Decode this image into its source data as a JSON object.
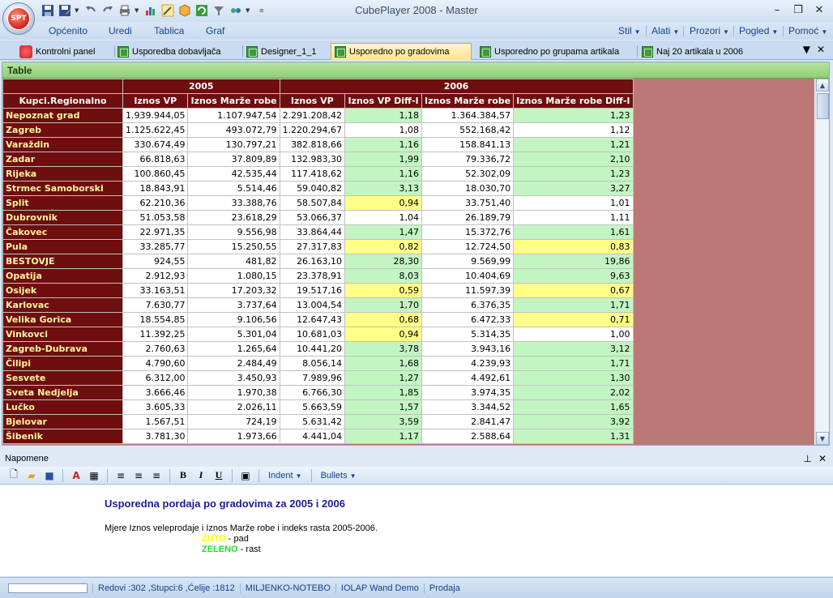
{
  "window": {
    "title": "CubePlayer 2008 - Master",
    "app_logo_text": "SPT"
  },
  "menu": {
    "items": [
      "Općenito",
      "Uredi",
      "Tablica",
      "Graf"
    ],
    "right_items": [
      "Stil",
      "Alati",
      "Prozori",
      "Pogled",
      "Pomoć"
    ]
  },
  "tabs": [
    {
      "label": "Kontrolni panel",
      "active": false
    },
    {
      "label": "Usporedba dobavljača",
      "active": false
    },
    {
      "label": "Designer_1_1",
      "active": false
    },
    {
      "label": "Usporedno po gradovima",
      "active": true
    },
    {
      "label": "Usporedno po grupama artikala",
      "active": false
    },
    {
      "label": "Naj 20 artikala u 2006",
      "active": false
    }
  ],
  "panel": {
    "title": "Table",
    "year_headers": [
      "2005",
      "2006"
    ],
    "row_header_title": "Kupci.Regionalno",
    "columns": [
      "Iznos VP",
      "Iznos Marže robe",
      "Iznos VP",
      "Iznos VP Diff-I",
      "Iznos Marže robe",
      "Iznos Marže robe Diff-I"
    ],
    "rows": [
      {
        "name": "Nepoznat grad",
        "v": [
          "1.939.944,05",
          "1.107.947,54",
          "2.291.208,42",
          "1,18",
          "1.364.384,57",
          "1,23"
        ],
        "c1": "green",
        "c2": "green"
      },
      {
        "name": "Zagreb",
        "v": [
          "1.125.622,45",
          "493.072,79",
          "1.220.294,67",
          "1,08",
          "552.168,42",
          "1,12"
        ],
        "c1": "white",
        "c2": "white"
      },
      {
        "name": "Varaždin",
        "v": [
          "330.674,49",
          "130.797,21",
          "382.818,66",
          "1,16",
          "158.841,13",
          "1,21"
        ],
        "c1": "green",
        "c2": "green"
      },
      {
        "name": "Zadar",
        "v": [
          "66.818,63",
          "37.809,89",
          "132.983,30",
          "1,99",
          "79.336,72",
          "2,10"
        ],
        "c1": "green",
        "c2": "green"
      },
      {
        "name": "Rijeka",
        "v": [
          "100.860,45",
          "42.535,44",
          "117.418,62",
          "1,16",
          "52.302,09",
          "1,23"
        ],
        "c1": "green",
        "c2": "green"
      },
      {
        "name": "Strmec Samoborski",
        "v": [
          "18.843,91",
          "5.514,46",
          "59.040,82",
          "3,13",
          "18.030,70",
          "3,27"
        ],
        "c1": "green",
        "c2": "green"
      },
      {
        "name": "Split",
        "v": [
          "62.210,36",
          "33.388,76",
          "58.507,84",
          "0,94",
          "33.751,40",
          "1,01"
        ],
        "c1": "yellow",
        "c2": "white"
      },
      {
        "name": "Dubrovnik",
        "v": [
          "51.053,58",
          "23.618,29",
          "53.066,37",
          "1,04",
          "26.189,79",
          "1,11"
        ],
        "c1": "white",
        "c2": "white"
      },
      {
        "name": "Čakovec",
        "v": [
          "22.971,35",
          "9.556,98",
          "33.864,44",
          "1,47",
          "15.372,76",
          "1,61"
        ],
        "c1": "green",
        "c2": "green"
      },
      {
        "name": "Pula",
        "v": [
          "33.285,77",
          "15.250,55",
          "27.317,83",
          "0,82",
          "12.724,50",
          "0,83"
        ],
        "c1": "yellow",
        "c2": "yellow"
      },
      {
        "name": "BESTOVJE",
        "v": [
          "924,55",
          "481,82",
          "26.163,10",
          "28,30",
          "9.569,99",
          "19,86"
        ],
        "c1": "green",
        "c2": "green"
      },
      {
        "name": "Opatija",
        "v": [
          "2.912,93",
          "1.080,15",
          "23.378,91",
          "8,03",
          "10.404,69",
          "9,63"
        ],
        "c1": "green",
        "c2": "green"
      },
      {
        "name": "Osijek",
        "v": [
          "33.163,51",
          "17.203,32",
          "19.517,16",
          "0,59",
          "11.597,39",
          "0,67"
        ],
        "c1": "yellow",
        "c2": "yellow"
      },
      {
        "name": "Karlovac",
        "v": [
          "7.630,77",
          "3.737,64",
          "13.004,54",
          "1,70",
          "6.376,35",
          "1,71"
        ],
        "c1": "green",
        "c2": "green"
      },
      {
        "name": "Velika Gorica",
        "v": [
          "18.554,85",
          "9.106,56",
          "12.647,43",
          "0,68",
          "6.472,33",
          "0,71"
        ],
        "c1": "yellow",
        "c2": "yellow"
      },
      {
        "name": "Vinkovci",
        "v": [
          "11.392,25",
          "5.301,04",
          "10.681,03",
          "0,94",
          "5.314,35",
          "1,00"
        ],
        "c1": "yellow",
        "c2": "white"
      },
      {
        "name": "Zagreb-Dubrava",
        "v": [
          "2.760,63",
          "1.265,64",
          "10.441,20",
          "3,78",
          "3.943,16",
          "3,12"
        ],
        "c1": "green",
        "c2": "green"
      },
      {
        "name": "Čilipi",
        "v": [
          "4.790,60",
          "2.484,49",
          "8.056,14",
          "1,68",
          "4.239,93",
          "1,71"
        ],
        "c1": "green",
        "c2": "green"
      },
      {
        "name": "Sesvete",
        "v": [
          "6.312,00",
          "3.450,93",
          "7.989,96",
          "1,27",
          "4.492,61",
          "1,30"
        ],
        "c1": "green",
        "c2": "green"
      },
      {
        "name": "Sveta Nedjelja",
        "v": [
          "3.666,46",
          "1.970,38",
          "6.766,30",
          "1,85",
          "3.974,35",
          "2,02"
        ],
        "c1": "green",
        "c2": "green"
      },
      {
        "name": "Lučko",
        "v": [
          "3.605,33",
          "2.026,11",
          "5.663,59",
          "1,57",
          "3.344,52",
          "1,65"
        ],
        "c1": "green",
        "c2": "green"
      },
      {
        "name": "Bjelovar",
        "v": [
          "1.567,51",
          "724,19",
          "5.631,42",
          "3,59",
          "2.841,47",
          "3,92"
        ],
        "c1": "green",
        "c2": "green"
      },
      {
        "name": "Šibenik",
        "v": [
          "3.781,30",
          "1.973,66",
          "4.441,04",
          "1,17",
          "2.588,64",
          "1,31"
        ],
        "c1": "green",
        "c2": "green"
      }
    ]
  },
  "notes": {
    "panel_title": "Napomene",
    "toolbar": {
      "indent_label": "Indent",
      "bullets_label": "Bullets"
    },
    "title": "Usporedna pordaja po gradovima za 2005 i 2006",
    "description": "Mjere Iznos veleprodaje i Iznos Marže robe i indeks rasta 2005-2006.",
    "legend_yellow_kw": "ŽUTO",
    "legend_yellow_text": " - pad",
    "legend_green_kw": "ZELENO",
    "legend_green_text": " - rast"
  },
  "status": {
    "counts": "Redovi :302 ,Stupci:6 ,Ćelije :1812",
    "machine": "MILJENKO-NOTEBO",
    "server": "IOLAP Wand Demo",
    "database": "Prodaja"
  },
  "colors": {
    "header_bg": "#6e0e0e",
    "row_label_text": "#fff5a0",
    "increase": "#c3f5c3",
    "decrease": "#ffff88",
    "grid_empty": "#bc7877",
    "panel_head": "#8ccf72"
  }
}
